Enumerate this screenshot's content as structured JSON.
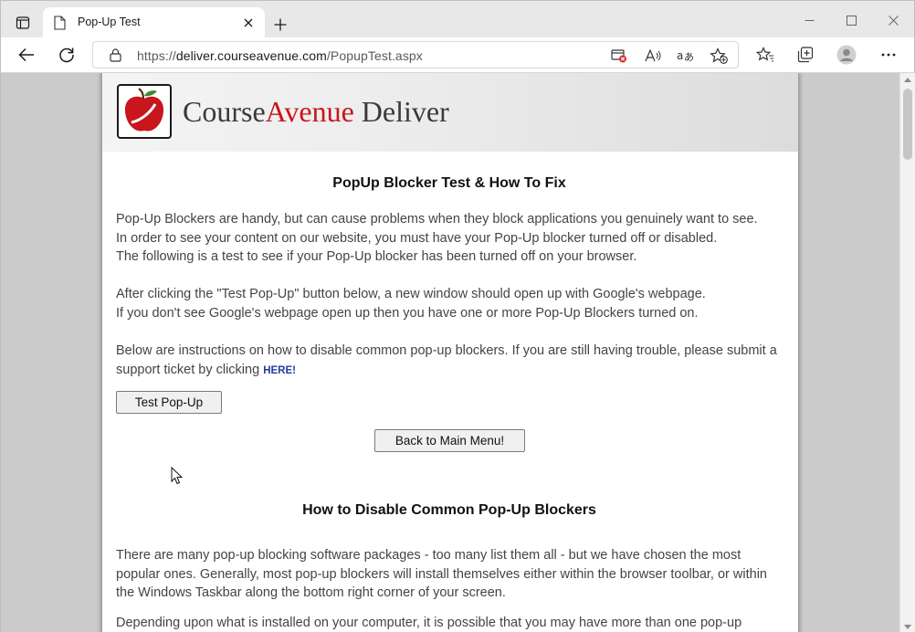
{
  "browser": {
    "tab_title": "Pop-Up Test",
    "url_prefix": "https://",
    "url_host": "deliver.courseavenue.com",
    "url_path": "/PopupTest.aspx"
  },
  "page": {
    "brand": {
      "part1": "Course",
      "part2": "Avenue",
      "part3": " Deliver"
    },
    "heading": "PopUp Blocker Test & How To Fix",
    "intro_lines": [
      "Pop-Up Blockers are handy, but can cause problems when they block applications you genuinely want to see.",
      "In order to see your content on our website, you must have your Pop-Up blocker turned off or disabled.",
      "The following is a test to see if your Pop-Up blocker has been turned off on your browser."
    ],
    "after_lines": [
      "After clicking the \"Test Pop-Up\" button below, a new window should open up with Google's webpage.",
      "If you don't see Google's webpage open up then you have one or more Pop-Up Blockers turned on."
    ],
    "instructions_text": "Below are instructions on how to disable common pop-up blockers.  If you are still having trouble, please submit a support ticket by clicking ",
    "here_link": "HERE!",
    "test_button": "Test Pop-Up",
    "back_button": "Back to Main Menu!",
    "heading2": "How to Disable Common Pop-Up Blockers",
    "body_para": "There are many pop-up blocking software packages -  too many list them all - but we have chosen the most popular ones. Generally, most pop-up blockers will install themselves either within the browser toolbar, or within the Windows Taskbar along the bottom right corner of your screen.",
    "partial_para": "Depending upon what is installed on your computer, it is possible that you may have more than one pop-up"
  },
  "colors": {
    "brand_red": "#c8161d",
    "link_blue": "#1f3d99",
    "page_bg": "#cbcbcb"
  }
}
